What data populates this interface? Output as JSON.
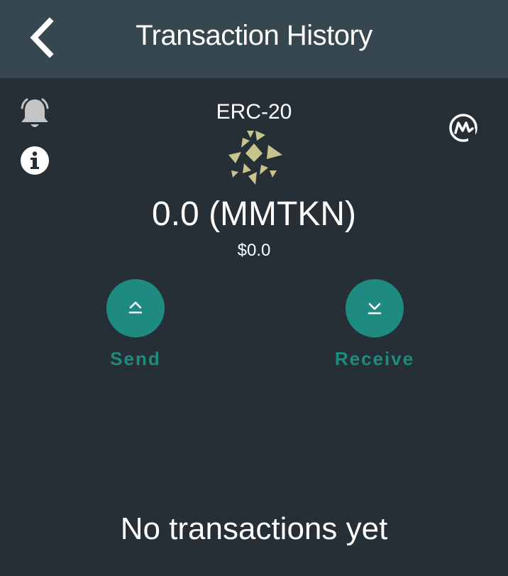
{
  "header": {
    "title": "Transaction History",
    "back_icon": "chevron-left-icon"
  },
  "toolbar": {
    "alerts_icon": "bell-icon",
    "info_icon": "info-icon",
    "market_icon": "coinmarketcap-icon"
  },
  "token": {
    "standard": "ERC-20",
    "logo_icon": "token-logo",
    "logo_color": "#c8c48e",
    "balance": "0.0 (MMTKN)",
    "fiat_value": "$0.0"
  },
  "actions": {
    "send_label": "Send",
    "send_icon": "arrow-up-icon",
    "receive_label": "Receive",
    "receive_icon": "arrow-down-icon",
    "accent_color": "#1f8a7f"
  },
  "transactions": {
    "empty_message": "No transactions yet"
  },
  "colors": {
    "background": "#262f36",
    "header": "#37474f"
  }
}
